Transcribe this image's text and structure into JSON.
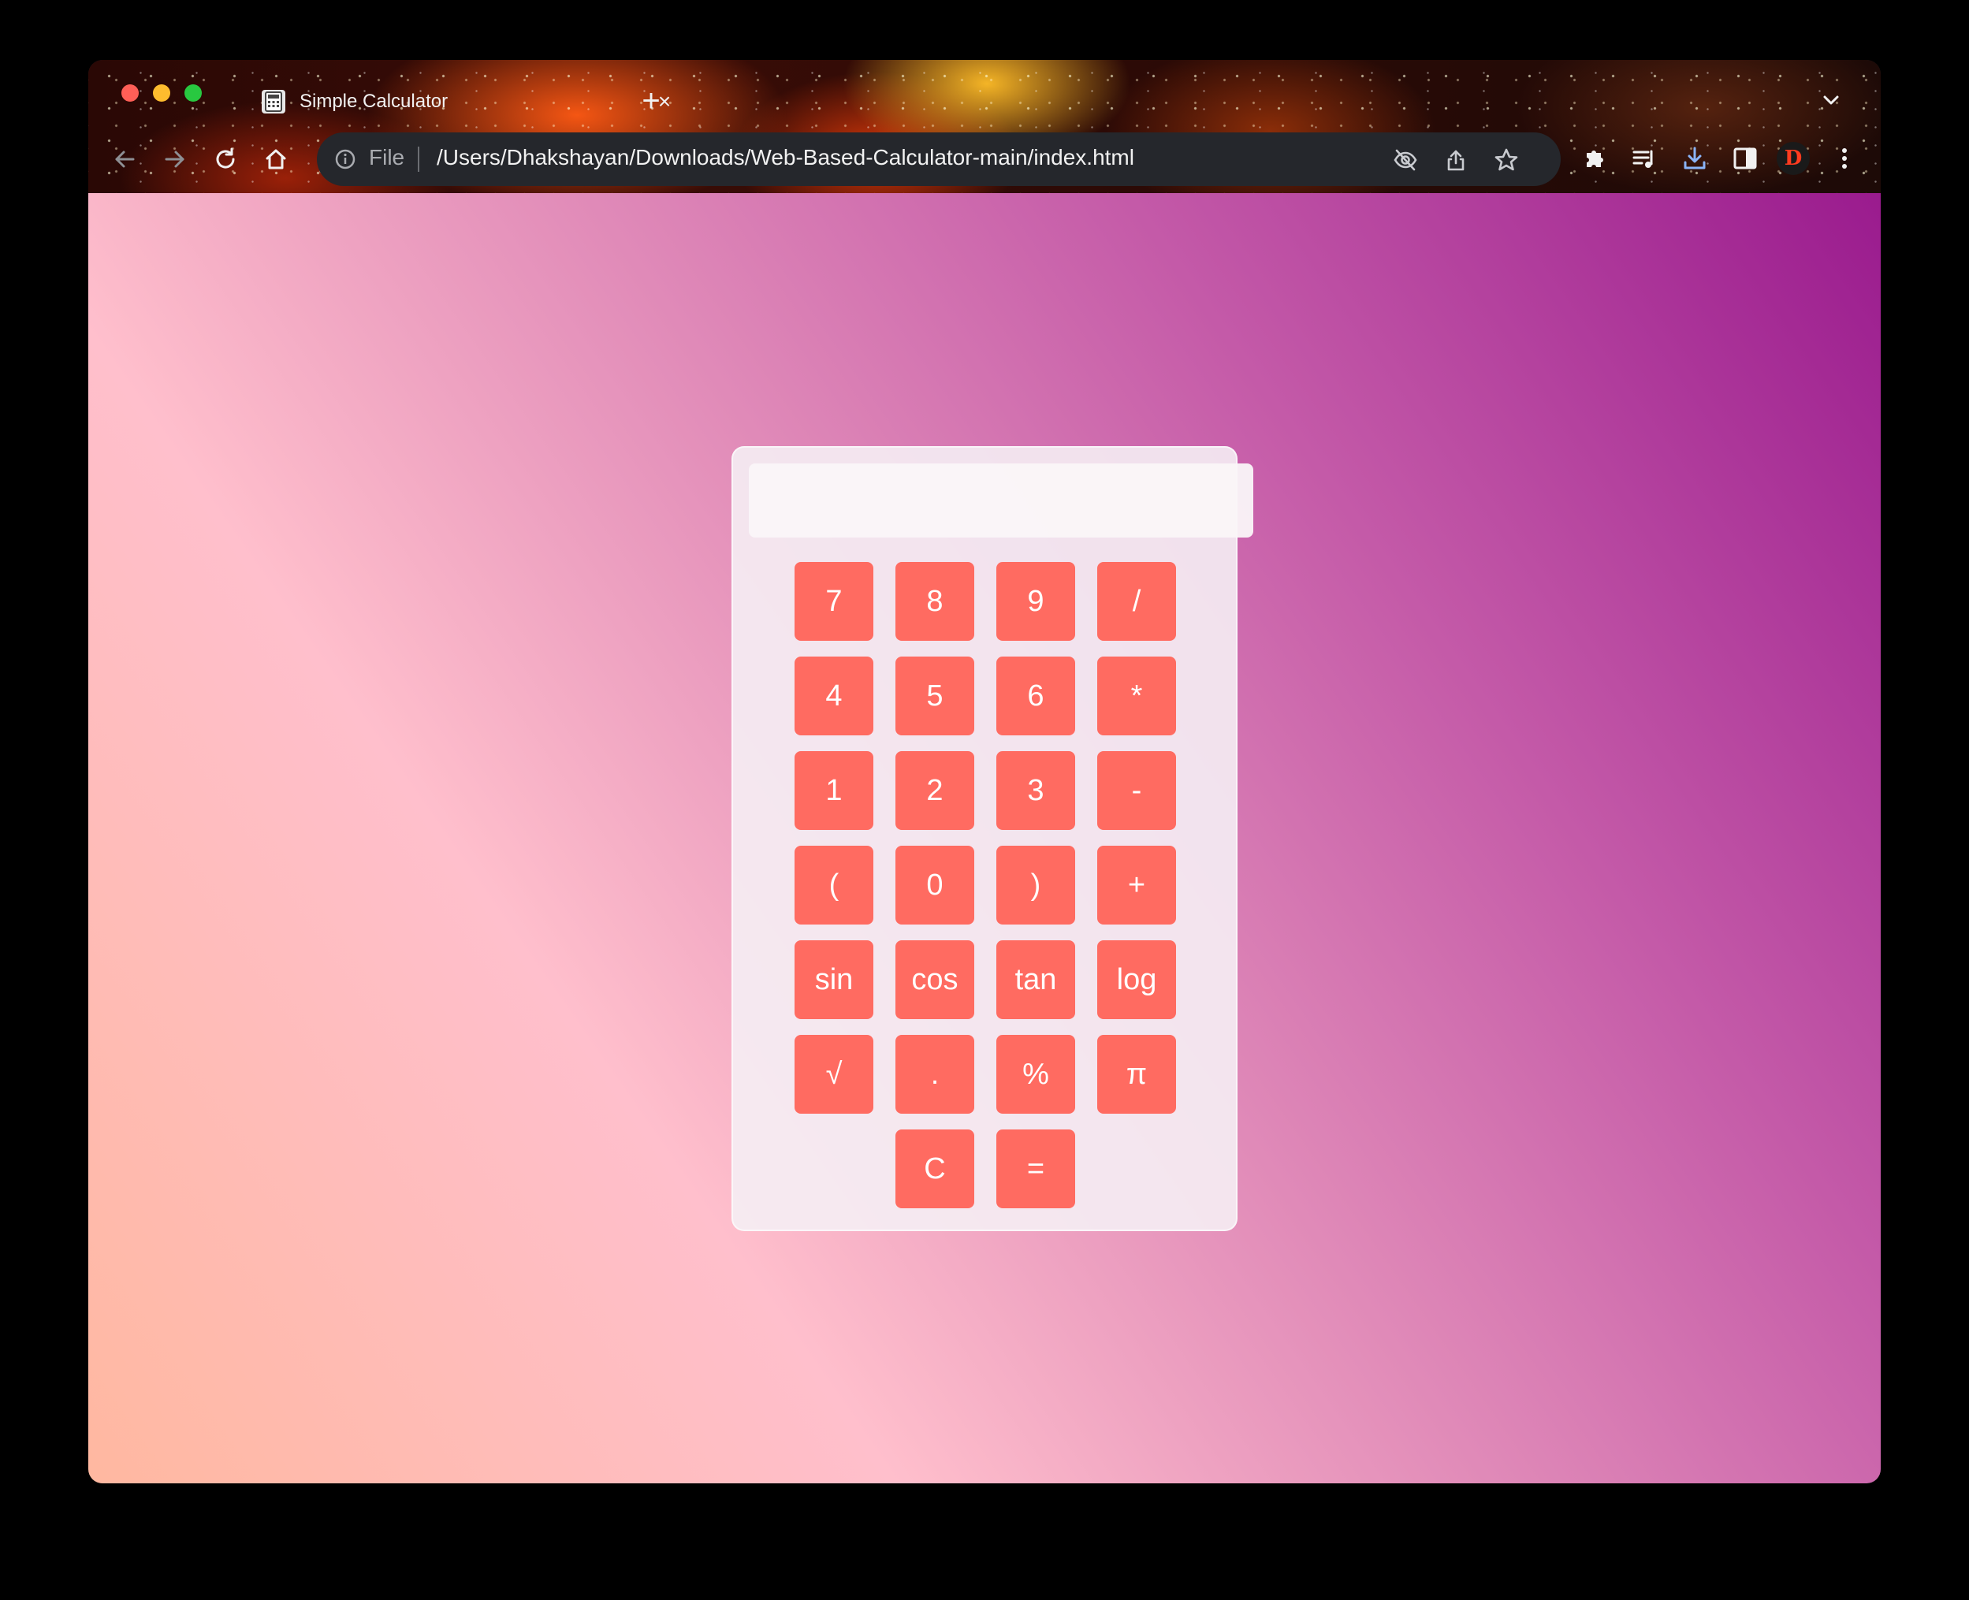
{
  "browser": {
    "tab_title": "Simple Calculator",
    "tab_close": "×",
    "new_tab": "+",
    "omnibox": {
      "scheme_label": "File",
      "url": "/Users/Dhakshayan/Downloads/Web-Based-Calculator-main/index.html"
    },
    "profile_initial": "D"
  },
  "calculator": {
    "display_value": "",
    "rows": [
      [
        "7",
        "8",
        "9",
        "/"
      ],
      [
        "4",
        "5",
        "6",
        "*"
      ],
      [
        "1",
        "2",
        "3",
        "-"
      ],
      [
        "(",
        "0",
        ")",
        "+"
      ],
      [
        "sin",
        "cos",
        "tan",
        "log"
      ],
      [
        "√",
        ".",
        "%",
        "π"
      ],
      [
        "C",
        "="
      ]
    ]
  },
  "colors": {
    "button": "#ff6b61",
    "button_text": "#ffffff",
    "panel": "#f5eef4"
  }
}
